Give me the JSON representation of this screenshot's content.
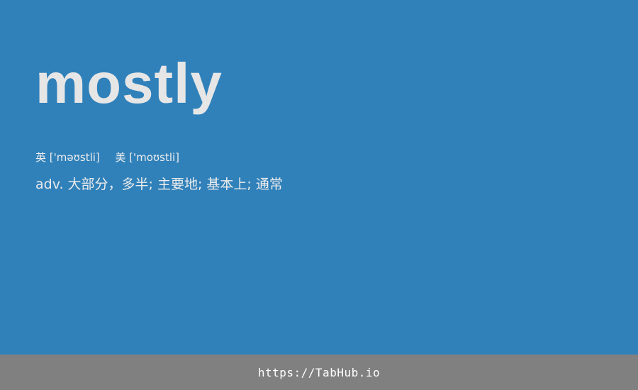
{
  "entry": {
    "word": "mostly",
    "pronunciation": {
      "uk_label": "英",
      "uk_ipa": "['məʊstli]",
      "us_label": "美",
      "us_ipa": "['moʊstli]"
    },
    "definition": "adv. 大部分，多半; 主要地; 基本上; 通常"
  },
  "footer": {
    "link": "https://TabHub.io"
  },
  "colors": {
    "background": "#3081ba",
    "footer_background": "#808080",
    "text": "#e6e6e6"
  }
}
